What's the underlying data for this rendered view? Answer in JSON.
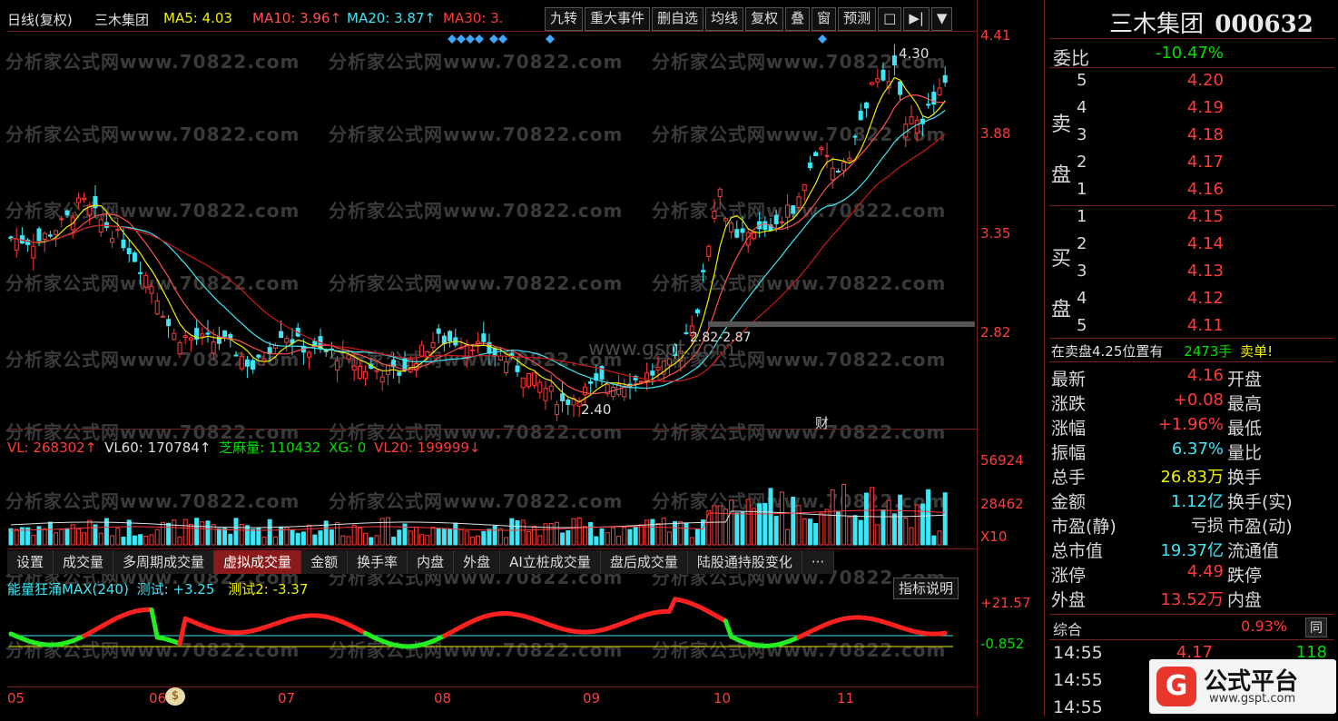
{
  "header": {
    "period": "日线(复权)",
    "stock_name": "三木集团",
    "ma": [
      {
        "label": "MA5: 4.03",
        "color": "#f0f000"
      },
      {
        "label": "MA10: 3.96↑",
        "color": "#ff5050"
      },
      {
        "label": "MA20: 3.87↑",
        "color": "#3ee7f5"
      },
      {
        "label": "MA30: 3.",
        "color": "#ff3b3b"
      }
    ],
    "toolbar": [
      "九转",
      "重大事件",
      "删自选",
      "均线",
      "复权",
      "叠",
      "窗",
      "预测"
    ]
  },
  "price_axis": [
    "4.41",
    "3.88",
    "3.35",
    "2.82"
  ],
  "annotations": {
    "high": "4.30",
    "low": "2.40",
    "range": "2.82-2.87",
    "cai": "财"
  },
  "watermark": "分析家公式网www.70822.com",
  "watermark2": "www.gspt.com",
  "volume": {
    "legend": [
      {
        "label": "VL: 268302↑",
        "color": "#ff3b3b"
      },
      {
        "label": "VL60: 170784↑",
        "color": "#e0e0e0"
      },
      {
        "label": "芝麻量: 110432",
        "color": "#00e000"
      },
      {
        "label": "XG: 0",
        "color": "#00e000"
      },
      {
        "label": "VL20: 199999↓",
        "color": "#ff3b3b"
      }
    ],
    "axis": [
      "56924",
      "28462",
      "X10"
    ]
  },
  "tabs": [
    "设置",
    "成交量",
    "多周期成交量",
    "虚拟成交量",
    "金额",
    "换手率",
    "内盘",
    "外盘",
    "AI立桩成交量",
    "盘后成交量",
    "陆股通持股变化",
    "···"
  ],
  "indicator": {
    "name": "能量狂涌MAX(240)",
    "t1": "测试: +3.25",
    "t2": "测试2: -3.37",
    "explain": "指标说明",
    "axis": [
      "+21.57",
      "-0.852"
    ]
  },
  "months": [
    "05",
    "06",
    "07",
    "08",
    "09",
    "10",
    "11"
  ],
  "right": {
    "title": "三木集团",
    "code": "000632",
    "weibi_label": "委比",
    "weibi_value": "-10.47%",
    "sell_label": "卖盘",
    "buy_label": "买盘",
    "sells": [
      {
        "n": "5",
        "p": "4.20"
      },
      {
        "n": "4",
        "p": "4.19"
      },
      {
        "n": "3",
        "p": "4.18"
      },
      {
        "n": "2",
        "p": "4.17"
      },
      {
        "n": "1",
        "p": "4.16"
      }
    ],
    "buys": [
      {
        "n": "1",
        "p": "4.15"
      },
      {
        "n": "2",
        "p": "4.14"
      },
      {
        "n": "3",
        "p": "4.13"
      },
      {
        "n": "4",
        "p": "4.12"
      },
      {
        "n": "5",
        "p": "4.11"
      }
    ],
    "notice": "在卖盘4.25位置有",
    "notice_qty": "2473手",
    "notice_end": "卖单!",
    "stats": [
      {
        "l": "最新",
        "v": "4.16",
        "vc": "#ff3b3b",
        "r": "开盘"
      },
      {
        "l": "涨跌",
        "v": "+0.08",
        "vc": "#ff3b3b",
        "r": "最高"
      },
      {
        "l": "涨幅",
        "v": "+1.96%",
        "vc": "#ff3b3b",
        "r": "最低"
      },
      {
        "l": "振幅",
        "v": "6.37%",
        "vc": "#3ee7f5",
        "r": "量比"
      },
      {
        "l": "总手",
        "v": "26.83万",
        "vc": "#f0f000",
        "r": "换手"
      },
      {
        "l": "金额",
        "v": "1.12亿",
        "vc": "#3ee7f5",
        "r": "换手(实)"
      },
      {
        "l": "市盈(静)",
        "v": "亏损",
        "vc": "#d8d8d8",
        "r": "市盈(动)"
      },
      {
        "l": "总市值",
        "v": "19.37亿",
        "vc": "#3ee7f5",
        "r": "流通值"
      },
      {
        "l": "涨停",
        "v": "4.49",
        "vc": "#ff3b3b",
        "r": "跌停"
      },
      {
        "l": "外盘",
        "v": "13.52万",
        "vc": "#ff3b3b",
        "r": "内盘"
      }
    ],
    "zonghe_label": "综合",
    "zonghe_value": "0.93%",
    "tongbi": "同",
    "ticks": [
      {
        "t": "14:55",
        "p": "4.17",
        "q": "118"
      },
      {
        "t": "14:55",
        "p": "",
        "q": ""
      },
      {
        "t": "14:55",
        "p": "",
        "q": ""
      }
    ],
    "brand": "公式平台",
    "brand_url": "www.gspt.com"
  }
}
